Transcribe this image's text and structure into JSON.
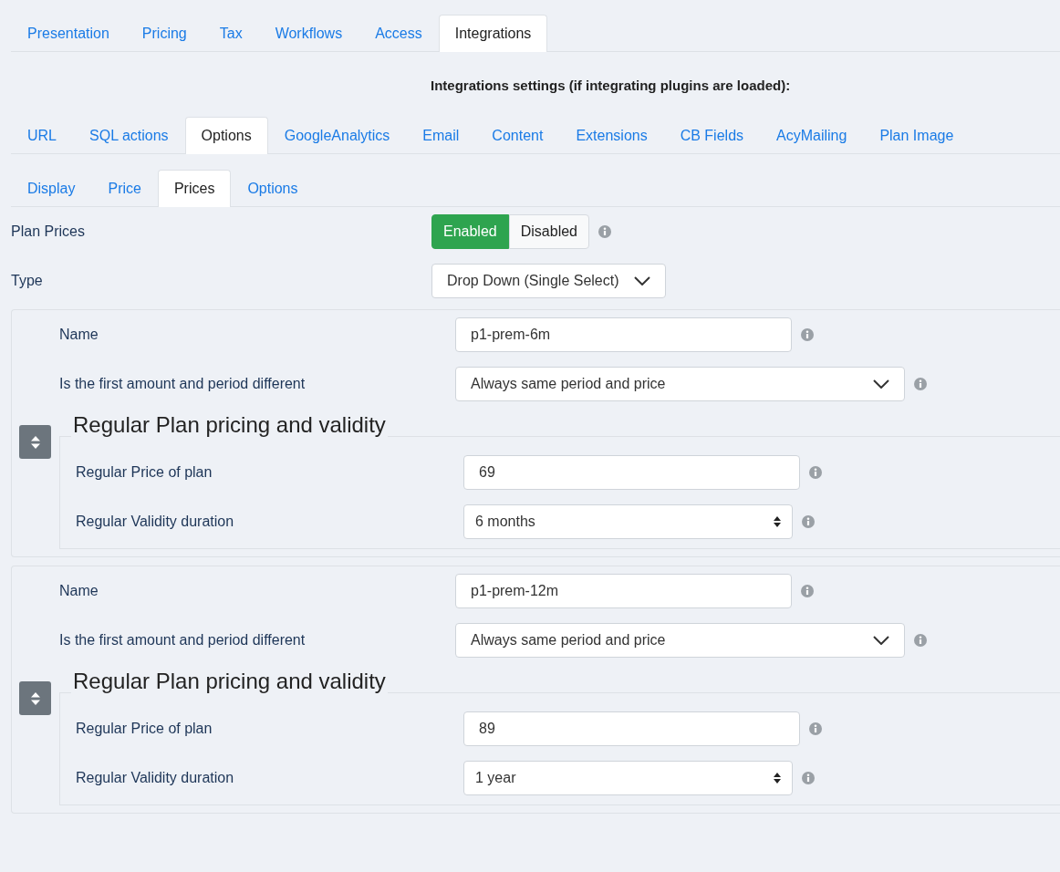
{
  "main_tabs": [
    {
      "label": "Presentation",
      "selected": false
    },
    {
      "label": "Pricing",
      "selected": false
    },
    {
      "label": "Tax",
      "selected": false
    },
    {
      "label": "Workflows",
      "selected": false
    },
    {
      "label": "Access",
      "selected": false
    },
    {
      "label": "Integrations",
      "selected": true
    }
  ],
  "heading": "Integrations settings (if integrating plugins are loaded):",
  "integration_tabs": [
    {
      "label": "URL",
      "selected": false
    },
    {
      "label": "SQL actions",
      "selected": false
    },
    {
      "label": "Options",
      "selected": true
    },
    {
      "label": "GoogleAnalytics",
      "selected": false
    },
    {
      "label": "Email",
      "selected": false
    },
    {
      "label": "Content",
      "selected": false
    },
    {
      "label": "Extensions",
      "selected": false
    },
    {
      "label": "CB Fields",
      "selected": false
    },
    {
      "label": "AcyMailing",
      "selected": false
    },
    {
      "label": "Plan Image",
      "selected": false
    }
  ],
  "option_tabs": [
    {
      "label": "Display",
      "selected": false
    },
    {
      "label": "Price",
      "selected": false
    },
    {
      "label": "Prices",
      "selected": true
    },
    {
      "label": "Options",
      "selected": false
    }
  ],
  "plan_prices": {
    "label": "Plan Prices",
    "options": [
      {
        "label": "Enabled",
        "selected": true
      },
      {
        "label": "Disabled",
        "selected": false
      }
    ]
  },
  "type": {
    "label": "Type",
    "value": "Drop Down (Single Select)"
  },
  "prices": [
    {
      "name_label": "Name",
      "name_value": "p1-prem-6m",
      "first_label": "Is the first amount and period different",
      "first_value": "Always same period and price",
      "legend": "Regular Plan pricing and validity",
      "price_label": "Regular Price of plan",
      "price_value": "69",
      "validity_label": "Regular Validity duration",
      "validity_value": "6 months"
    },
    {
      "name_label": "Name",
      "name_value": "p1-prem-12m",
      "first_label": "Is the first amount and period different",
      "first_value": "Always same period and price",
      "legend": "Regular Plan pricing and validity",
      "price_label": "Regular Price of plan",
      "price_value": "89",
      "validity_label": "Regular Validity duration",
      "validity_value": "1 year"
    }
  ]
}
